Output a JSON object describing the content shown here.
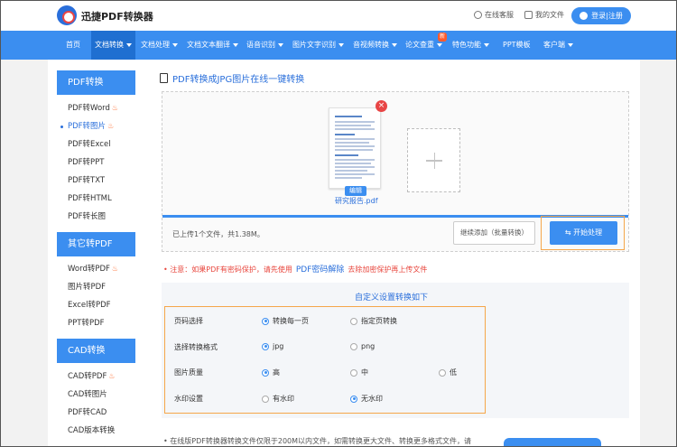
{
  "header": {
    "logo_text": "迅捷PDF转换器",
    "service_label": "在线客服",
    "files_label": "我的文件",
    "login_label": "登录|注册"
  },
  "nav": {
    "items": [
      {
        "label": "首页"
      },
      {
        "label": "文档转换"
      },
      {
        "label": "文档处理"
      },
      {
        "label": "文档文本翻译"
      },
      {
        "label": "语音识别"
      },
      {
        "label": "图片文字识别"
      },
      {
        "label": "音视频转换"
      },
      {
        "label": "论文查重"
      },
      {
        "label": "特色功能"
      },
      {
        "label": "PPT模板"
      },
      {
        "label": "客户端"
      }
    ],
    "new_badge": "新"
  },
  "sidebar": {
    "sections": [
      {
        "title": "PDF转换",
        "items": [
          "PDF转Word",
          "PDF转图片",
          "PDF转Excel",
          "PDF转PPT",
          "PDF转TXT",
          "PDF转HTML",
          "PDF转长图"
        ]
      },
      {
        "title": "其它转PDF",
        "items": [
          "Word转PDF",
          "图片转PDF",
          "Excel转PDF",
          "PPT转PDF"
        ]
      },
      {
        "title": "CAD转换",
        "items": [
          "CAD转PDF",
          "CAD转图片",
          "PDF转CAD",
          "CAD版本转换"
        ]
      }
    ],
    "active_item": "PDF转图片"
  },
  "main": {
    "title": "PDF转换成JPG图片在线一键转换",
    "file": {
      "name": "研究报告.pdf",
      "edit_label": "编辑"
    },
    "upload_progress": 1.0,
    "status_text": "已上传1个文件，共1.38M。",
    "continue_label": "继续添加（批量转换）",
    "start_label": "开始处理"
  },
  "notice": {
    "text_before": "注意：如果PDF有密码保护，请先使用",
    "link": "PDF密码解除",
    "text_after": "去除加密保护再上传文件"
  },
  "settings": {
    "title": "自定义设置转换如下",
    "rows": [
      {
        "label": "页码选择",
        "options": [
          "转换每一页",
          "指定页转换"
        ],
        "selected": 0
      },
      {
        "label": "选择转换格式",
        "options": [
          "jpg",
          "png"
        ],
        "selected": 0
      },
      {
        "label": "图片质量",
        "options": [
          "高",
          "中",
          "低"
        ],
        "selected": 0
      },
      {
        "label": "水印设置",
        "options": [
          "有水印",
          "无水印"
        ],
        "selected": 1
      }
    ]
  },
  "bottom_text": "在线版PDF转换器转换文件仅限于200M以内文件，如需转换更大文件、转换更多格式文件，请",
  "colors": {
    "primary": "#3b8ef0",
    "accent_orange": "#f5a64a",
    "warn_red": "#e8453c"
  }
}
